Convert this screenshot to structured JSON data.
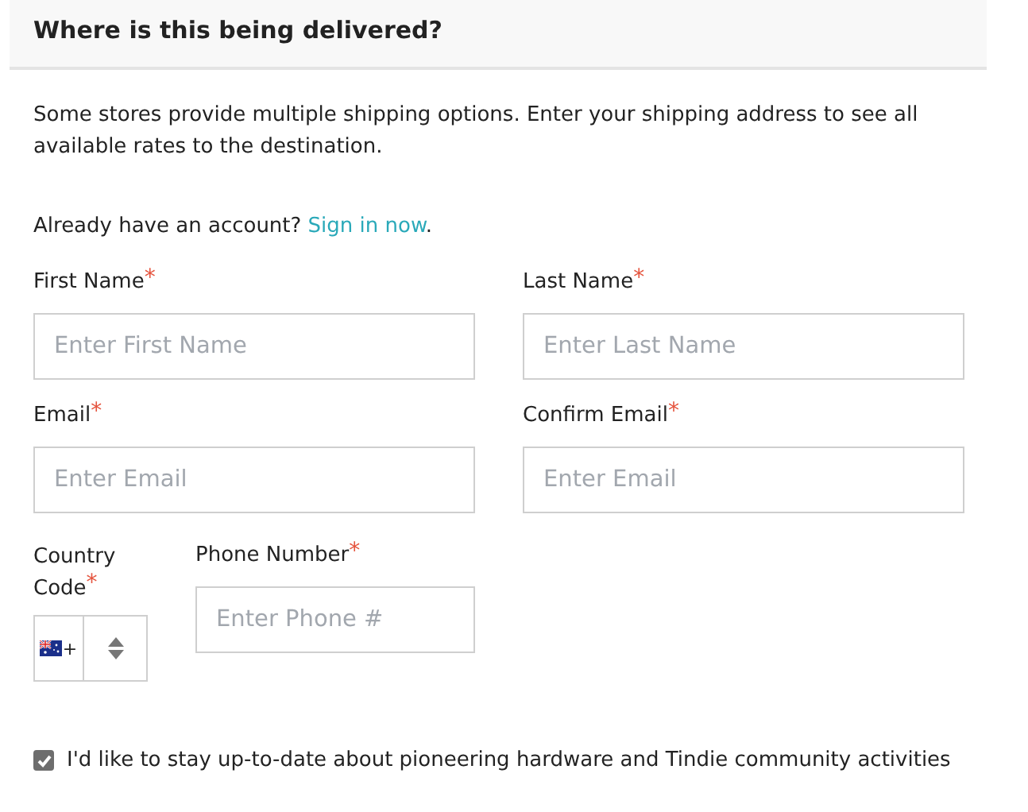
{
  "header": {
    "title": "Where is this being delivered?"
  },
  "intro": "Some stores provide multiple shipping options. Enter your shipping address to see all available rates to the destination.",
  "account": {
    "prompt": "Already have an account?",
    "link": "Sign in now",
    "after": "."
  },
  "fields": [
    {
      "label": "First Name",
      "marker": "*",
      "placeholder": "Enter First Name"
    },
    {
      "label": "Last Name",
      "marker": "*",
      "placeholder": "Enter Last Name"
    },
    {
      "label": "Email",
      "marker": "*",
      "placeholder": "Enter Email"
    },
    {
      "label": "Confirm Email",
      "marker": "*",
      "placeholder": "Enter Email"
    }
  ],
  "country_code": {
    "label": "Country Code",
    "marker": "*",
    "prefix": "+"
  },
  "phone": {
    "label": "Phone Number",
    "marker": "*",
    "placeholder": "Enter Phone #"
  },
  "newsletter": {
    "label": "I'd like to stay up-to-date about pioneering hardware and Tindie community activities",
    "checked": true
  }
}
